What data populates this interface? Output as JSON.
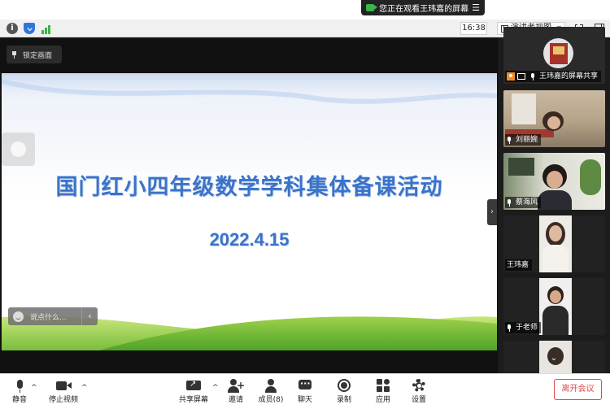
{
  "share_banner": {
    "text": "您正在观看王玮嘉的屏幕",
    "menu_icon": "menu-icon"
  },
  "toolbar": {
    "time": "16:38",
    "view_mode": "演讲者视图",
    "icons": [
      "info-icon",
      "shield-icon",
      "signal-icon",
      "fullscreen-icon",
      "panel-icon"
    ]
  },
  "main": {
    "lock_label": "锁定画面",
    "slide": {
      "title": "国门红小四年级数学学科集体备课活动",
      "date": "2022.4.15"
    },
    "chat_placeholder": "说点什么..."
  },
  "participants": [
    {
      "name": "王玮嘉的屏幕共享"
    },
    {
      "name": "刘丽婉"
    },
    {
      "name": "蔡海风"
    },
    {
      "name": "王玮嘉"
    },
    {
      "name": "于老师"
    }
  ],
  "controls": {
    "mute": "静音",
    "stop_video": "停止视频",
    "share_screen": "共享屏幕",
    "invite": "邀请",
    "members": "成员(8)",
    "chat": "聊天",
    "record": "录制",
    "apps": "应用",
    "settings": "设置",
    "leave": "离开会议"
  },
  "colors": {
    "accent_green": "#39b54a",
    "leave_red": "#e04848",
    "slide_title": "#3a73c9"
  }
}
